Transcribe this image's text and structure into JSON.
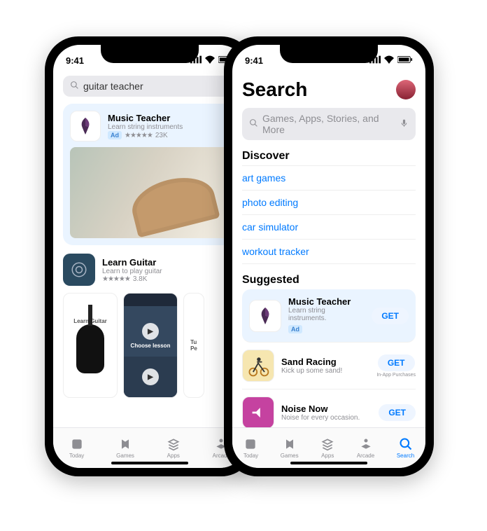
{
  "status": {
    "time": "9:41"
  },
  "left": {
    "search_value": "guitar teacher",
    "ad": {
      "title": "Music Teacher",
      "subtitle": "Learn string instruments",
      "badge": "Ad",
      "rating_count": "23K"
    },
    "result": {
      "title": "Learn Guitar",
      "subtitle": "Learn to play guitar",
      "rating_count": "3.8K"
    },
    "thumbs": {
      "t1_label": "Learn Guitar",
      "t2_label": "Choose lesson",
      "t3_label": "Tu\nPe"
    }
  },
  "right": {
    "page_title": "Search",
    "search_placeholder": "Games, Apps, Stories, and More",
    "discover_header": "Discover",
    "discover_links": [
      "art games",
      "photo editing",
      "car simulator",
      "workout tracker"
    ],
    "suggested_header": "Suggested",
    "suggested": [
      {
        "title": "Music Teacher",
        "subtitle": "Learn string instruments.",
        "badge": "Ad",
        "get": "GET",
        "iap": ""
      },
      {
        "title": "Sand Racing",
        "subtitle": "Kick up some sand!",
        "badge": "",
        "get": "GET",
        "iap": "In-App Purchases"
      },
      {
        "title": "Noise Now",
        "subtitle": "Noise for every occasion.",
        "badge": "",
        "get": "GET",
        "iap": ""
      }
    ]
  },
  "tabs": {
    "today": "Today",
    "games": "Games",
    "apps": "Apps",
    "arcade": "Arcade",
    "search": "Search"
  }
}
